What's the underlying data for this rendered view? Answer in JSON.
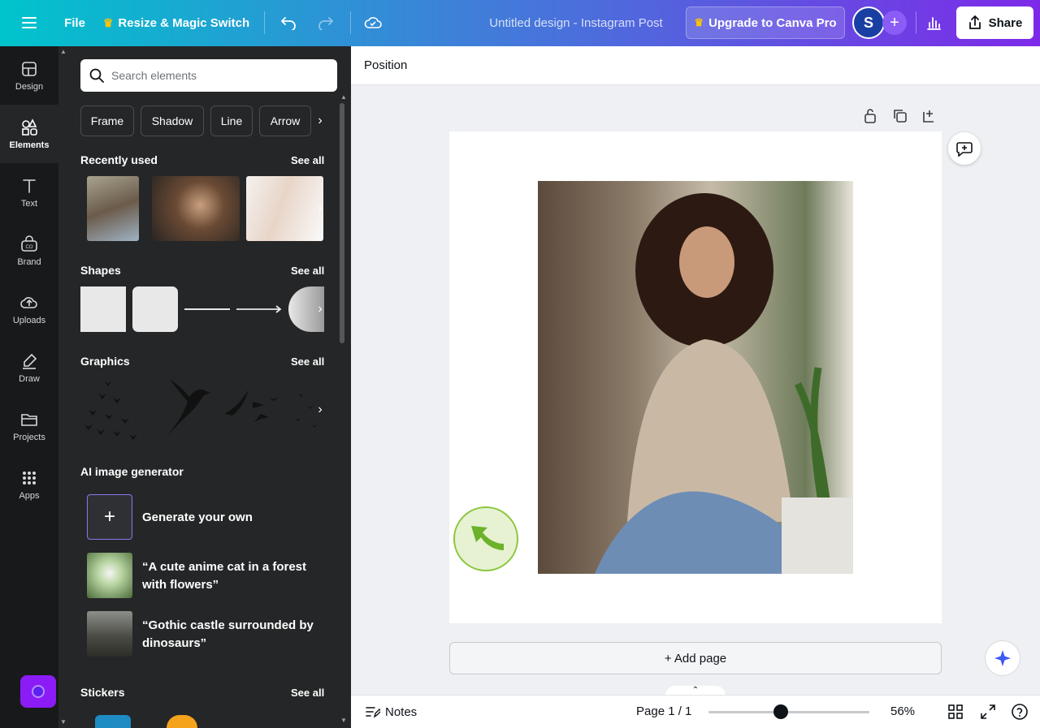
{
  "topbar": {
    "file_label": "File",
    "resize_label": "Resize & Magic Switch",
    "title": "Untitled design - Instagram Post",
    "upgrade_label": "Upgrade to Canva Pro",
    "avatar_initial": "S",
    "share_label": "Share"
  },
  "nav": {
    "items": [
      {
        "label": "Design",
        "icon": "design-icon"
      },
      {
        "label": "Elements",
        "icon": "elements-icon"
      },
      {
        "label": "Text",
        "icon": "text-icon"
      },
      {
        "label": "Brand",
        "icon": "brand-icon"
      },
      {
        "label": "Uploads",
        "icon": "uploads-icon"
      },
      {
        "label": "Draw",
        "icon": "draw-icon"
      },
      {
        "label": "Projects",
        "icon": "projects-icon"
      },
      {
        "label": "Apps",
        "icon": "apps-icon"
      }
    ]
  },
  "panel": {
    "search_placeholder": "Search elements",
    "chips": [
      "Frame",
      "Shadow",
      "Line",
      "Arrow"
    ],
    "recently_used": {
      "title": "Recently used",
      "see_all": "See all"
    },
    "shapes": {
      "title": "Shapes",
      "see_all": "See all"
    },
    "graphics": {
      "title": "Graphics",
      "see_all": "See all"
    },
    "ai": {
      "title": "AI image generator",
      "generate_label": "Generate your own",
      "prompt1": "“A cute anime cat in a forest with flowers”",
      "prompt2": "“Gothic castle surrounded by dinosaurs”"
    },
    "stickers": {
      "title": "Stickers",
      "see_all": "See all"
    }
  },
  "editor": {
    "position_label": "Position",
    "add_page_label": "+ Add page"
  },
  "bottom": {
    "notes_label": "Notes",
    "page_indicator": "Page 1 / 1",
    "zoom": "56%",
    "zoom_fraction": 0.45
  },
  "colors": {
    "accent_purple": "#7d2ae8",
    "teal": "#00c4cc",
    "nav_bg": "#18191b",
    "panel_bg": "#252627"
  }
}
